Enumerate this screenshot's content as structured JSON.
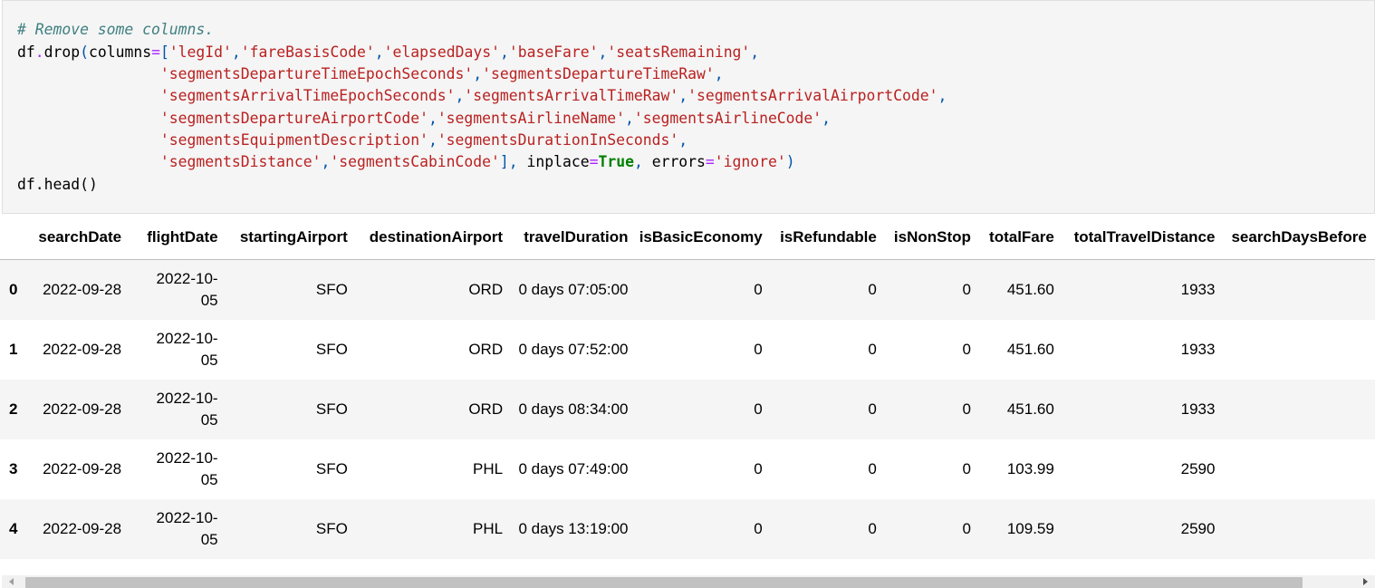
{
  "code": {
    "comment": "# Remove some columns.",
    "drop_columns": [
      "legId",
      "fareBasisCode",
      "elapsedDays",
      "baseFare",
      "seatsRemaining",
      "segmentsDepartureTimeEpochSeconds",
      "segmentsDepartureTimeRaw",
      "segmentsArrivalTimeEpochSeconds",
      "segmentsArrivalTimeRaw",
      "segmentsArrivalAirportCode",
      "segmentsDepartureAirportCode",
      "segmentsAirlineName",
      "segmentsAirlineCode",
      "segmentsEquipmentDescription",
      "segmentsDurationInSeconds",
      "segmentsDistance",
      "segmentsCabinCode"
    ],
    "inplace_value": "True",
    "errors_value": "'ignore'",
    "head_call": "df.head()"
  },
  "table": {
    "columns": [
      "",
      "searchDate",
      "flightDate",
      "startingAirport",
      "destinationAirport",
      "travelDuration",
      "isBasicEconomy",
      "isRefundable",
      "isNonStop",
      "totalFare",
      "totalTravelDistance",
      "searchDaysBefore"
    ],
    "rows": [
      {
        "index": "0",
        "searchDate": "2022-09-28",
        "flightDate": "2022-10-05",
        "startingAirport": "SFO",
        "destinationAirport": "ORD",
        "travelDuration": "0 days 07:05:00",
        "isBasicEconomy": "0",
        "isRefundable": "0",
        "isNonStop": "0",
        "totalFare": "451.60",
        "totalTravelDistance": "1933",
        "searchDaysBefore": ""
      },
      {
        "index": "1",
        "searchDate": "2022-09-28",
        "flightDate": "2022-10-05",
        "startingAirport": "SFO",
        "destinationAirport": "ORD",
        "travelDuration": "0 days 07:52:00",
        "isBasicEconomy": "0",
        "isRefundable": "0",
        "isNonStop": "0",
        "totalFare": "451.60",
        "totalTravelDistance": "1933",
        "searchDaysBefore": ""
      },
      {
        "index": "2",
        "searchDate": "2022-09-28",
        "flightDate": "2022-10-05",
        "startingAirport": "SFO",
        "destinationAirport": "ORD",
        "travelDuration": "0 days 08:34:00",
        "isBasicEconomy": "0",
        "isRefundable": "0",
        "isNonStop": "0",
        "totalFare": "451.60",
        "totalTravelDistance": "1933",
        "searchDaysBefore": ""
      },
      {
        "index": "3",
        "searchDate": "2022-09-28",
        "flightDate": "2022-10-05",
        "startingAirport": "SFO",
        "destinationAirport": "PHL",
        "travelDuration": "0 days 07:49:00",
        "isBasicEconomy": "0",
        "isRefundable": "0",
        "isNonStop": "0",
        "totalFare": "103.99",
        "totalTravelDistance": "2590",
        "searchDaysBefore": ""
      },
      {
        "index": "4",
        "searchDate": "2022-09-28",
        "flightDate": "2022-10-05",
        "startingAirport": "SFO",
        "destinationAirport": "PHL",
        "travelDuration": "0 days 13:19:00",
        "isBasicEconomy": "0",
        "isRefundable": "0",
        "isNonStop": "0",
        "totalFare": "109.59",
        "totalTravelDistance": "2590",
        "searchDaysBefore": ""
      }
    ]
  },
  "colors": {
    "comment": "#408080",
    "string": "#ba2121",
    "operator": "#aa22ff",
    "keyword": "#008000",
    "cell_bg": "#f5f5f5"
  },
  "scrollbar": {
    "left_arrow_icon": "chevron-left-icon",
    "right_arrow_icon": "chevron-right-icon"
  }
}
